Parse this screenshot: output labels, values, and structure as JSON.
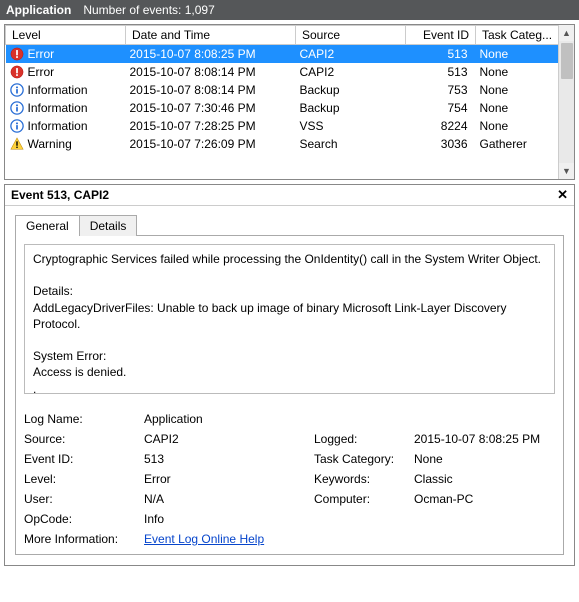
{
  "header": {
    "title": "Application",
    "subtitle": "Number of events: 1,097"
  },
  "columns": [
    "Level",
    "Date and Time",
    "Source",
    "Event ID",
    "Task Categ..."
  ],
  "rows": [
    {
      "icon": "error",
      "level": "Error",
      "dt": "2015-10-07 8:08:25 PM",
      "source": "CAPI2",
      "id": "513",
      "cat": "None",
      "selected": true
    },
    {
      "icon": "error",
      "level": "Error",
      "dt": "2015-10-07 8:08:14 PM",
      "source": "CAPI2",
      "id": "513",
      "cat": "None"
    },
    {
      "icon": "info",
      "level": "Information",
      "dt": "2015-10-07 8:08:14 PM",
      "source": "Backup",
      "id": "753",
      "cat": "None"
    },
    {
      "icon": "info",
      "level": "Information",
      "dt": "2015-10-07 7:30:46 PM",
      "source": "Backup",
      "id": "754",
      "cat": "None"
    },
    {
      "icon": "info",
      "level": "Information",
      "dt": "2015-10-07 7:28:25 PM",
      "source": "VSS",
      "id": "8224",
      "cat": "None"
    },
    {
      "icon": "warning",
      "level": "Warning",
      "dt": "2015-10-07 7:26:09 PM",
      "source": "Search",
      "id": "3036",
      "cat": "Gatherer"
    }
  ],
  "detail": {
    "title": "Event 513, CAPI2",
    "tabs": {
      "general": "General",
      "details": "Details"
    },
    "message": "Cryptographic Services failed while processing the OnIdentity() call in the System Writer Object.\n\nDetails:\nAddLegacyDriverFiles: Unable to back up image of binary Microsoft Link-Layer Discovery Protocol.\n\nSystem Error:\nAccess is denied.\n.",
    "kv": {
      "logname_l": "Log Name:",
      "logname_v": "Application",
      "source_l": "Source:",
      "source_v": "CAPI2",
      "logged_l": "Logged:",
      "logged_v": "2015-10-07 8:08:25 PM",
      "eventid_l": "Event ID:",
      "eventid_v": "513",
      "taskcat_l": "Task Category:",
      "taskcat_v": "None",
      "level_l": "Level:",
      "level_v": "Error",
      "keywords_l": "Keywords:",
      "keywords_v": "Classic",
      "user_l": "User:",
      "user_v": "N/A",
      "computer_l": "Computer:",
      "computer_v": "Ocman-PC",
      "opcode_l": "OpCode:",
      "opcode_v": "Info",
      "moreinfo_l": "More Information:",
      "moreinfo_link": "Event Log Online Help"
    }
  }
}
